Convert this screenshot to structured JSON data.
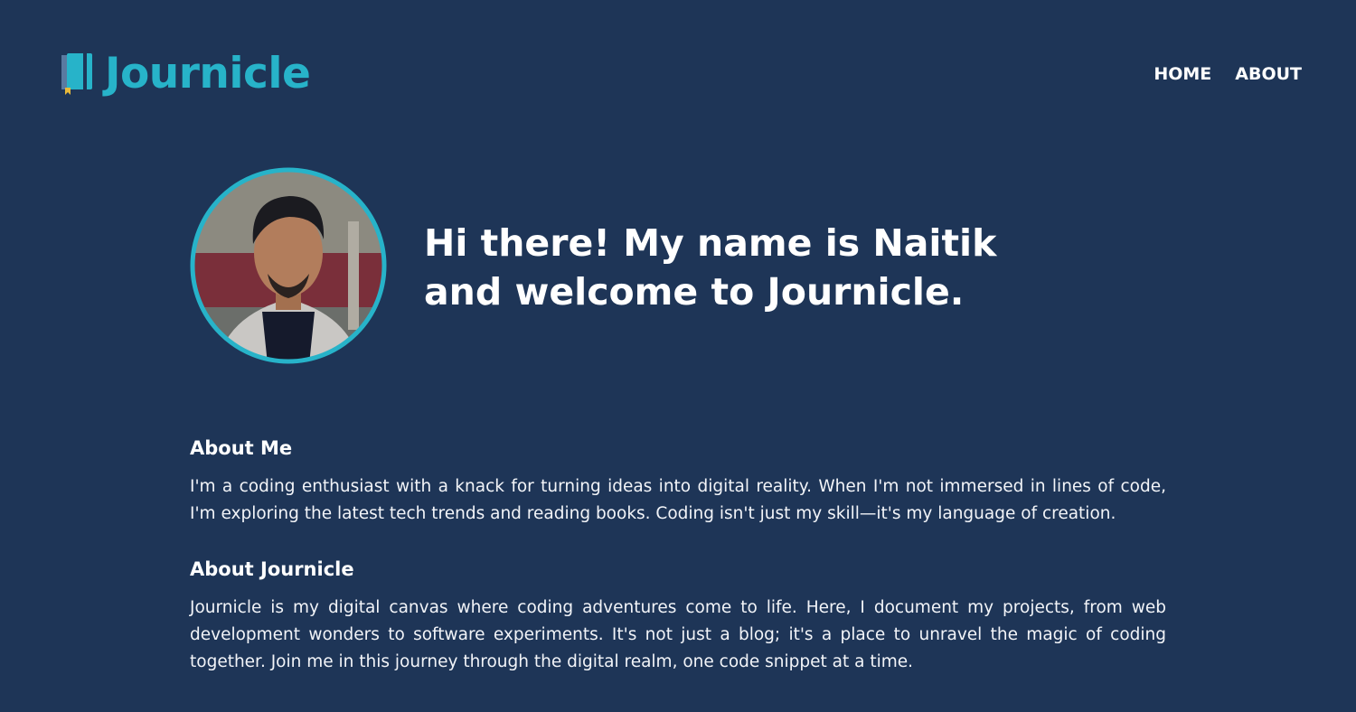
{
  "brand": {
    "name": "Journicle",
    "logo_icon": "book-icon",
    "accent_color": "#27b3c9"
  },
  "nav": {
    "items": [
      {
        "label": "HOME"
      },
      {
        "label": "ABOUT"
      }
    ]
  },
  "hero": {
    "greeting_line1": "Hi there! My name is Naitik",
    "greeting_line2": "and welcome to Journicle.",
    "avatar_alt": "profile photo"
  },
  "sections": [
    {
      "title": "About Me",
      "body": "I'm a coding enthusiast with a knack for turning ideas into digital reality. When I'm not immersed in lines of code, I'm exploring the latest tech trends and reading books. Coding isn't just my skill—it's my language of creation."
    },
    {
      "title": "About Journicle",
      "body": "Journicle is my digital canvas where coding adventures come to life. Here, I document my projects, from web development wonders to software experiments. It's not just a blog; it's a place to unravel the magic of coding together. Join me in this journey through the digital realm, one code snippet at a time."
    }
  ],
  "colors": {
    "background": "#1e3557",
    "text": "#ffffff"
  }
}
